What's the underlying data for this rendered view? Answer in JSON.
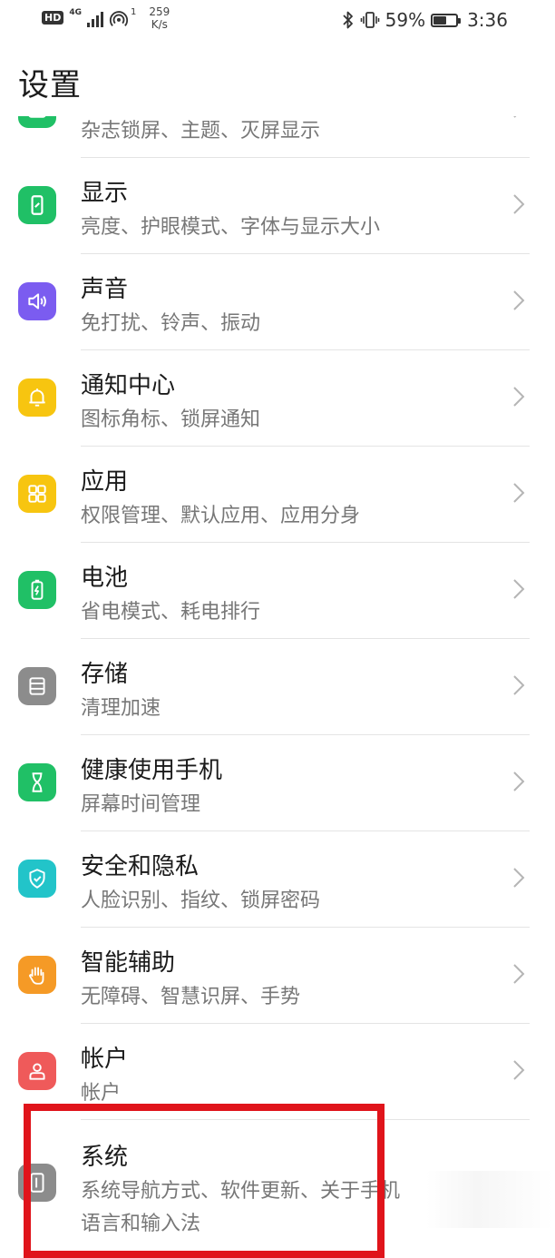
{
  "status_bar": {
    "hd": "HD",
    "net_type": "4G",
    "wifi_sup": "1",
    "speed_value": "259",
    "speed_unit": "K/s",
    "battery_percent": "59%",
    "battery_level": 0.59,
    "time": "3:36"
  },
  "header": {
    "title": "设置"
  },
  "settings": {
    "items": [
      {
        "title": "",
        "subtitle": "杂志锁屏、主题、灭屏显示",
        "icon": "image-icon",
        "color": "#20c066"
      },
      {
        "title": "显示",
        "subtitle": "亮度、护眼模式、字体与显示大小",
        "icon": "display-icon",
        "color": "#20c066"
      },
      {
        "title": "声音",
        "subtitle": "免打扰、铃声、振动",
        "icon": "speaker-icon",
        "color": "#7b5cf0"
      },
      {
        "title": "通知中心",
        "subtitle": "图标角标、锁屏通知",
        "icon": "bell-icon",
        "color": "#f7c510"
      },
      {
        "title": "应用",
        "subtitle": "权限管理、默认应用、应用分身",
        "icon": "apps-grid-icon",
        "color": "#f7c510"
      },
      {
        "title": "电池",
        "subtitle": "省电模式、耗电排行",
        "icon": "battery-icon",
        "color": "#20c066"
      },
      {
        "title": "存储",
        "subtitle": "清理加速",
        "icon": "storage-icon",
        "color": "#8c8c8c"
      },
      {
        "title": "健康使用手机",
        "subtitle": "屏幕时间管理",
        "icon": "hourglass-icon",
        "color": "#20c066"
      },
      {
        "title": "安全和隐私",
        "subtitle": "人脸识别、指纹、锁屏密码",
        "icon": "shield-check-icon",
        "color": "#22c4c9"
      },
      {
        "title": "智能辅助",
        "subtitle": "无障碍、智慧识屏、手势",
        "icon": "hand-icon",
        "color": "#f59a26"
      },
      {
        "title": "帐户",
        "subtitle": "帐户",
        "icon": "user-icon",
        "color": "#ef5a5a"
      },
      {
        "title": "系统",
        "subtitle": "系统导航方式、软件更新、关于手机",
        "subtitle2": "语言和输入法",
        "icon": "phone-icon",
        "color": "#8c8c8c"
      }
    ]
  },
  "highlight_color": "#e0141b"
}
